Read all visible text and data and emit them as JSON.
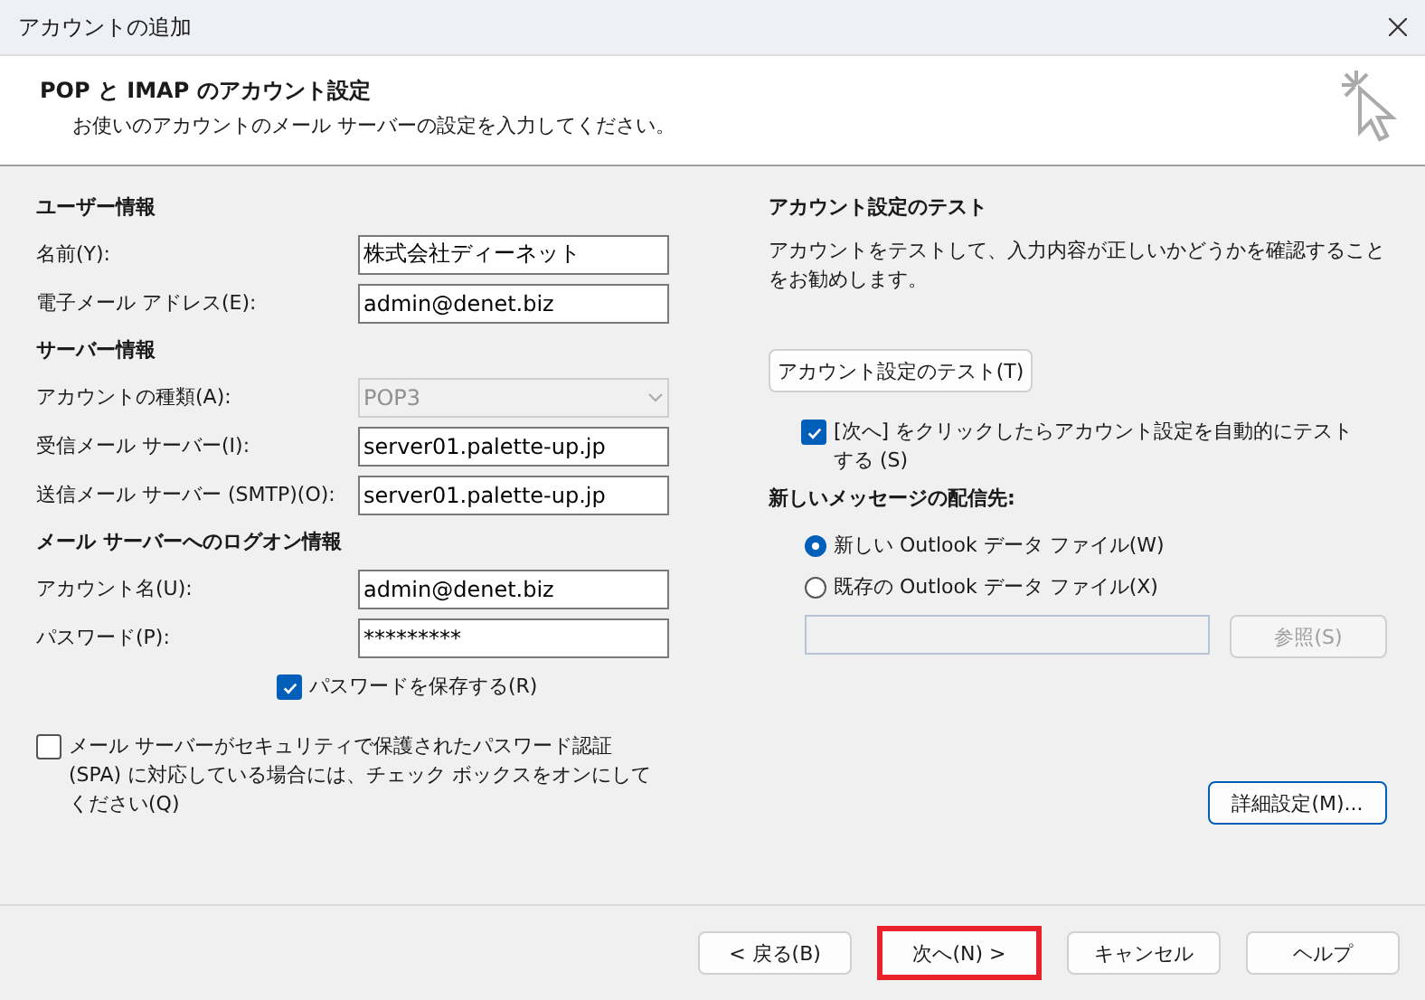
{
  "window": {
    "title": "アカウントの追加"
  },
  "header": {
    "title": "POP と IMAP のアカウント設定",
    "subtitle": "お使いのアカウントのメール サーバーの設定を入力してください。"
  },
  "left": {
    "sections": [
      {
        "heading": "ユーザー情報",
        "fields": [
          {
            "kind": "text",
            "label": "名前(Y):",
            "value": "株式会社ディーネット"
          },
          {
            "kind": "text",
            "label": "電子メール アドレス(E):",
            "value": "admin@denet.biz"
          }
        ]
      },
      {
        "heading": "サーバー情報",
        "fields": [
          {
            "kind": "select",
            "label": "アカウントの種類(A):",
            "value": "POP3",
            "disabled": true
          },
          {
            "kind": "text",
            "label": "受信メール サーバー(I):",
            "value": "server01.palette-up.jp"
          },
          {
            "kind": "text",
            "label": "送信メール サーバー (SMTP)(O):",
            "value": "server01.palette-up.jp"
          }
        ]
      },
      {
        "heading": "メール サーバーへのログオン情報",
        "fields": [
          {
            "kind": "text",
            "label": "アカウント名(U):",
            "value": "admin@denet.biz"
          },
          {
            "kind": "text",
            "label": "パスワード(P):",
            "value": "*********"
          }
        ]
      }
    ],
    "save_password": {
      "label": "パスワードを保存する(R)",
      "checked": true
    },
    "spa": {
      "label": "メール サーバーがセキュリティで保護されたパスワード認証 (SPA) に対応している場合には、チェック ボックスをオンにしてください(Q)",
      "checked": false
    }
  },
  "right": {
    "heading": "アカウント設定のテスト",
    "description": "アカウントをテストして、入力内容が正しいかどうかを確認することをお勧めします。",
    "test_button": "アカウント設定のテスト(T)",
    "auto_test": {
      "label": "[次へ] をクリックしたらアカウント設定を自動的にテストする (S)",
      "checked": true
    },
    "delivery_heading": "新しいメッセージの配信先:",
    "delivery_options": [
      {
        "label": "新しい Outlook データ ファイル(W)",
        "selected": true
      },
      {
        "label": "既存の Outlook データ ファイル(X)",
        "selected": false
      }
    ],
    "browse_button": {
      "label": "参照(S)",
      "disabled": true
    },
    "advanced_button": "詳細設定(M)..."
  },
  "footer": {
    "buttons": [
      {
        "label": "< 戻る(B)",
        "highlighted": false
      },
      {
        "label": "次へ(N) >",
        "highlighted": true
      },
      {
        "label": "キャンセル",
        "highlighted": false
      },
      {
        "label": "ヘルプ",
        "highlighted": false
      }
    ]
  }
}
